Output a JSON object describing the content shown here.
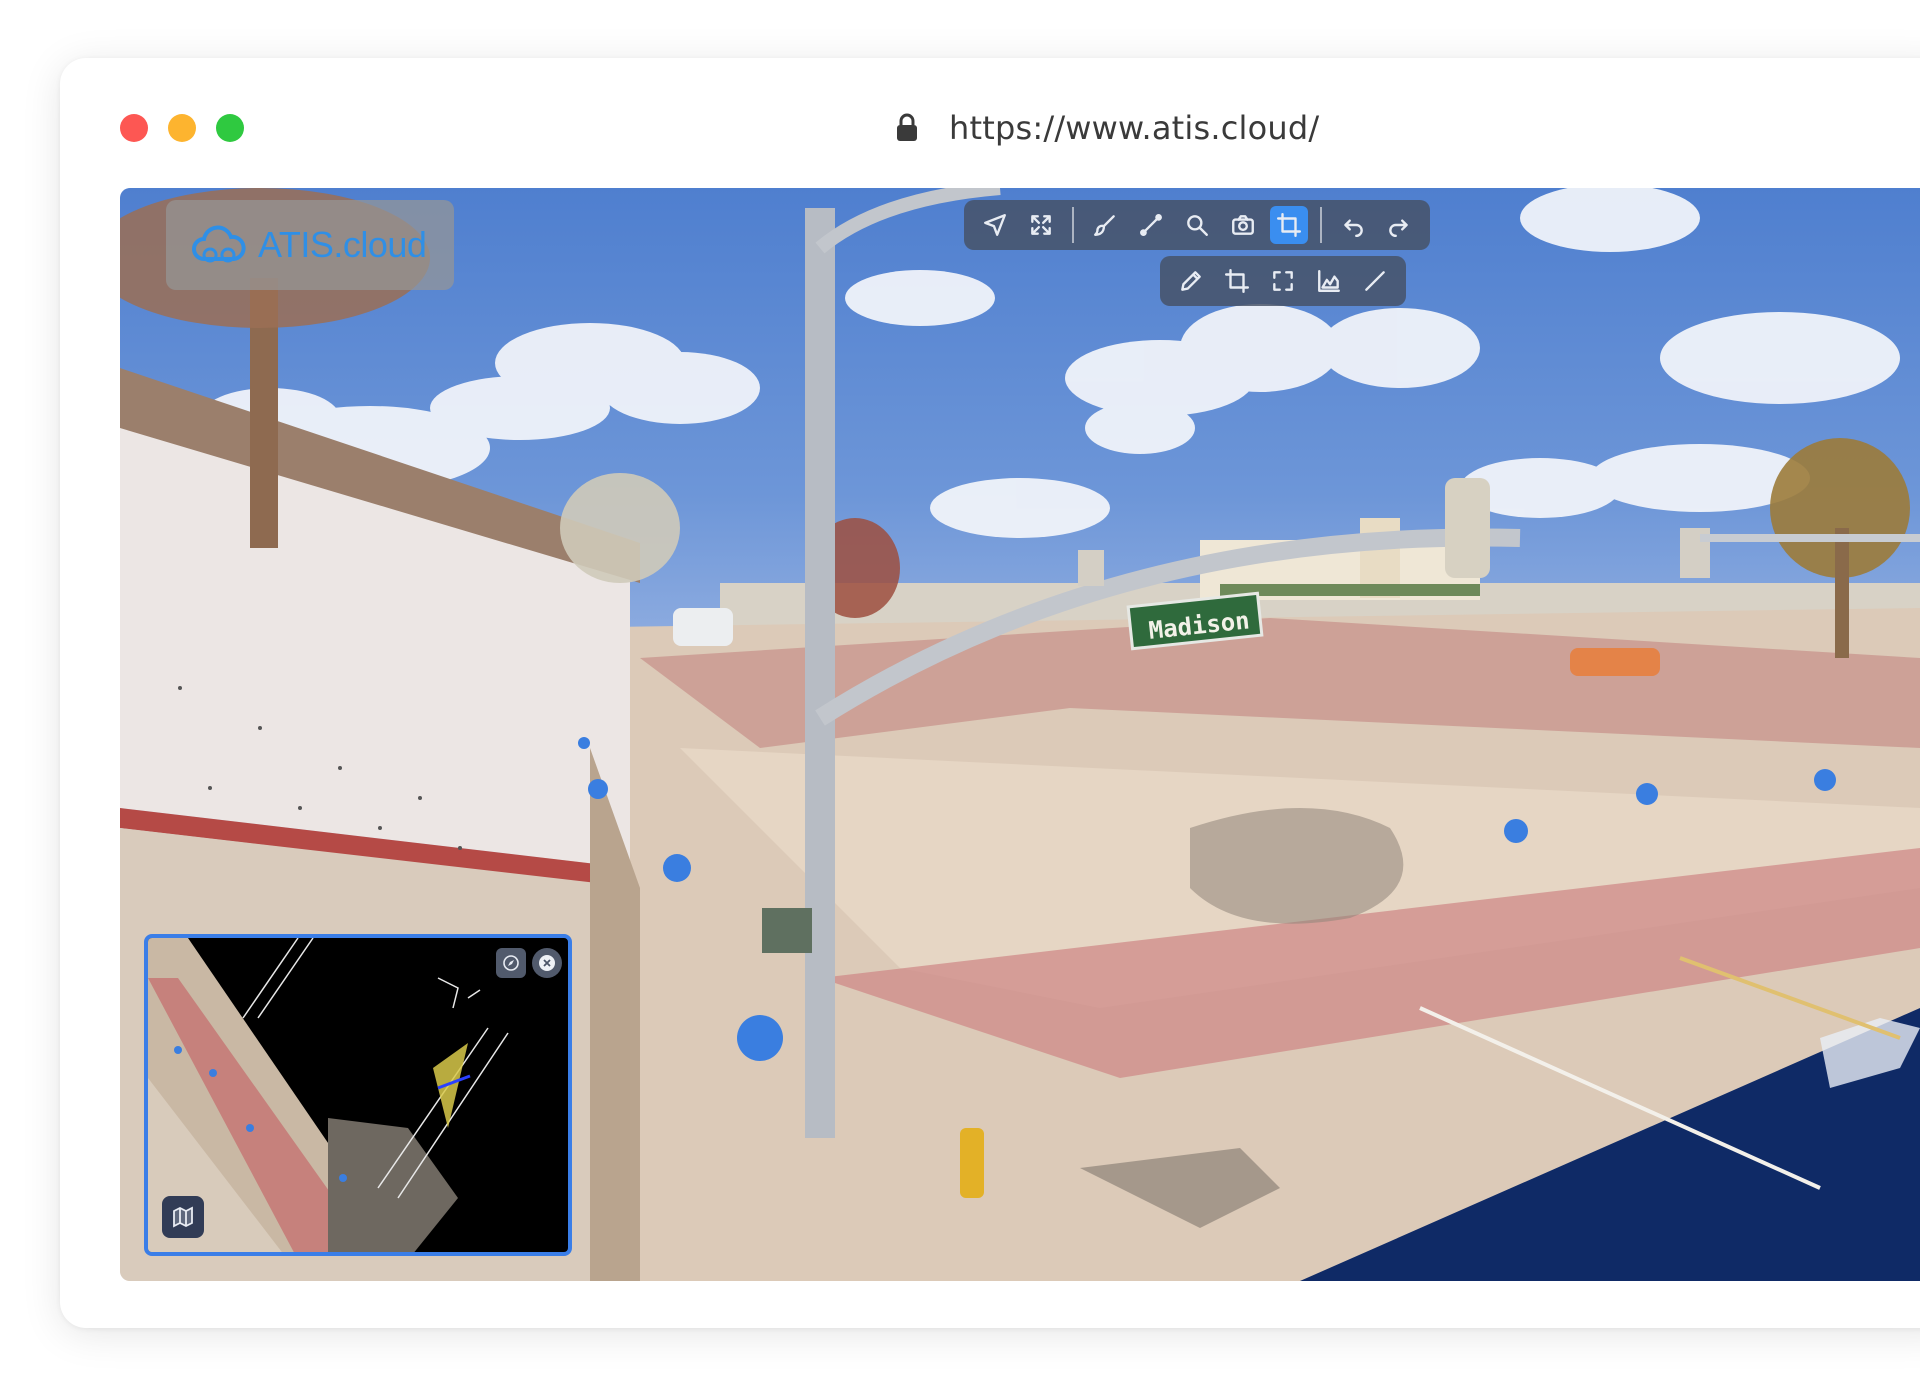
{
  "browser": {
    "url": "https://www.atis.cloud/"
  },
  "app": {
    "logo_text": "ATIS.cloud",
    "street_sign_text": "Madison"
  },
  "toolbar": {
    "main_tools": [
      {
        "icon": "navigate-arrow-icon",
        "active": false
      },
      {
        "icon": "fullscreen-expand-icon",
        "active": false
      },
      {
        "icon": "brush-icon",
        "active": false
      },
      {
        "icon": "measure-line-icon",
        "active": false
      },
      {
        "icon": "zoom-search-icon",
        "active": false
      },
      {
        "icon": "camera-icon",
        "active": false
      },
      {
        "icon": "crop-icon",
        "active": true
      },
      {
        "icon": "undo-icon",
        "active": false
      },
      {
        "icon": "redo-icon",
        "active": false
      }
    ],
    "sub_tools": [
      {
        "icon": "pencil-icon",
        "active": false
      },
      {
        "icon": "crop-icon",
        "active": false
      },
      {
        "icon": "focus-frame-icon",
        "active": false
      },
      {
        "icon": "profile-chart-icon",
        "active": false
      },
      {
        "icon": "line-tool-icon",
        "active": false
      }
    ]
  },
  "minimap": {
    "buttons": [
      "compass-icon",
      "close-icon",
      "map-icon"
    ]
  },
  "colors": {
    "accent": "#3a8ef0",
    "minimap_border": "#3a7ee8",
    "toolbar_bg": "#46506480",
    "marker": "#3a7ee0"
  }
}
